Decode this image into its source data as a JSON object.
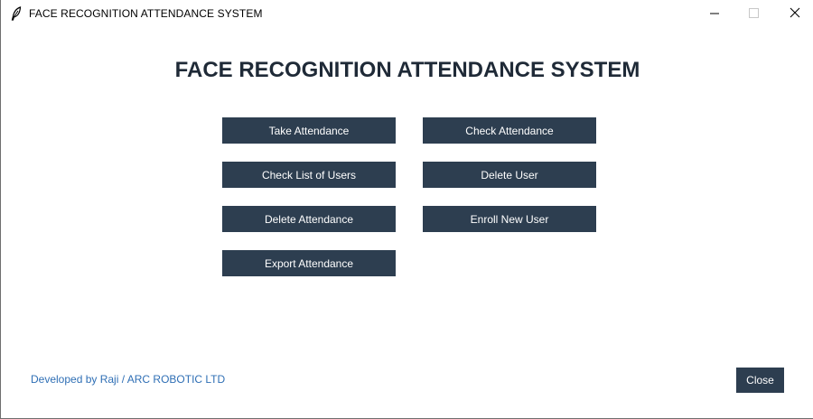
{
  "window": {
    "title": "FACE RECOGNITION ATTENDANCE SYSTEM",
    "app_icon": "feather-icon",
    "controls": {
      "minimize_icon": "minimize-icon",
      "maximize_icon": "maximize-icon",
      "close_icon": "close-icon"
    }
  },
  "main": {
    "heading": "FACE RECOGNITION ATTENDANCE SYSTEM",
    "buttons": {
      "take_attendance": "Take Attendance",
      "check_attendance": "Check Attendance",
      "check_list_of_users": "Check List of Users",
      "delete_user": "Delete User",
      "delete_attendance": "Delete Attendance",
      "enroll_new_user": "Enroll New User",
      "export_attendance": "Export Attendance"
    }
  },
  "footer": {
    "credit": "Developed by Raji / ARC ROBOTIC LTD",
    "close_label": "Close"
  },
  "colors": {
    "button_bg": "#2d3e50",
    "button_text": "#ffffff",
    "heading": "#1f2a37",
    "credit": "#2f6fb5"
  }
}
